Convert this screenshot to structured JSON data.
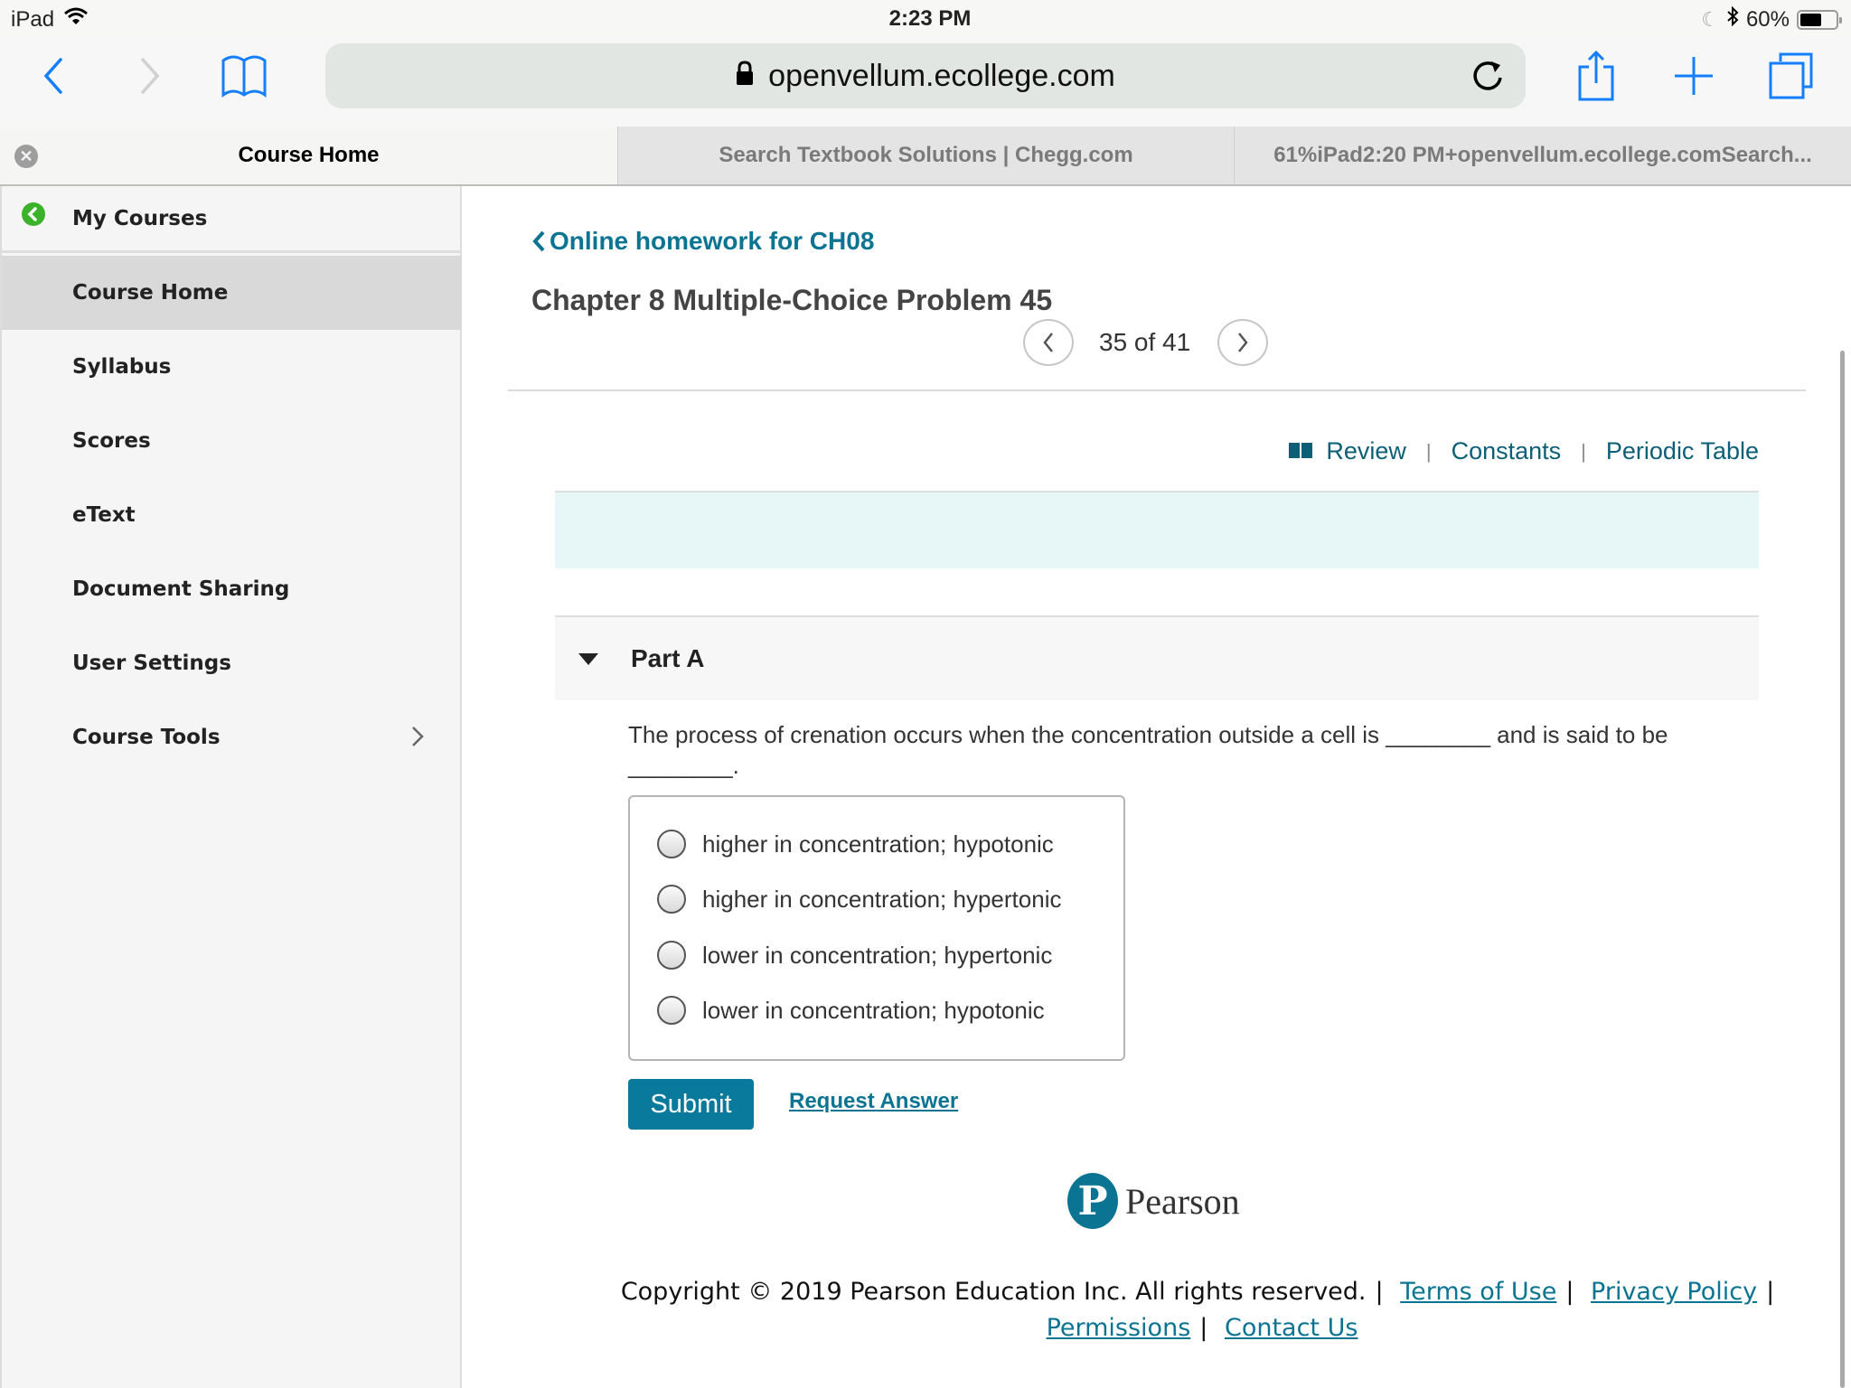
{
  "status_bar": {
    "device": "iPad",
    "time": "2:23 PM",
    "battery_percent": "60%",
    "battery_level": 0.6
  },
  "browser": {
    "url": "openvellum.ecollege.com",
    "icons": {
      "back": "chevron-left-icon",
      "forward": "chevron-right-icon",
      "bookmarks": "book-icon",
      "reload": "reload-icon",
      "share": "share-icon",
      "new_tab": "plus-icon",
      "tabs": "tabs-icon"
    },
    "tabs": [
      {
        "title": "Course Home",
        "active": true
      },
      {
        "title": "Search Textbook Solutions | Chegg.com",
        "active": false
      },
      {
        "title": "61%iPad2:20 PM+openvellum.ecollege.comSearch...",
        "active": false
      }
    ]
  },
  "sidebar": {
    "back_label": "My Courses",
    "items": [
      {
        "label": "Course Home",
        "active": true
      },
      {
        "label": "Syllabus",
        "active": false
      },
      {
        "label": "Scores",
        "active": false
      },
      {
        "label": "eText",
        "active": false
      },
      {
        "label": "Document Sharing",
        "active": false
      },
      {
        "label": "User Settings",
        "active": false
      },
      {
        "label": "Course Tools",
        "active": false,
        "has_submenu": true
      }
    ]
  },
  "problem": {
    "back_link": "Online homework for CH08",
    "title": "Chapter 8 Multiple-Choice Problem 45",
    "pager": {
      "current": 35,
      "total": 41,
      "text": "35 of 41"
    },
    "resource_links": [
      "Review",
      "Constants",
      "Periodic Table"
    ],
    "part": {
      "title": "Part A",
      "question": "The process of crenation occurs when the concentration outside a cell is ________ and is said to be ________.",
      "options": [
        "higher in concentration; hypotonic",
        "higher in concentration; hypertonic",
        "lower in concentration; hypertonic",
        "lower in concentration; hypotonic"
      ],
      "submit_label": "Submit",
      "request_answer_label": "Request Answer"
    }
  },
  "footer": {
    "brand": "Pearson",
    "copyright": "Copyright © 2019 Pearson Education Inc. All rights reserved.",
    "links": [
      "Terms of Use",
      "Privacy Policy",
      "Permissions",
      "Contact Us"
    ]
  },
  "colors": {
    "accent": "#0b7493",
    "submit": "#0a7a9c",
    "intro_box": "#e7f6f6",
    "sidebar_active": "#d9d9d9",
    "my_courses_icon": "#3cb22a",
    "ios_blue": "#157efb"
  }
}
